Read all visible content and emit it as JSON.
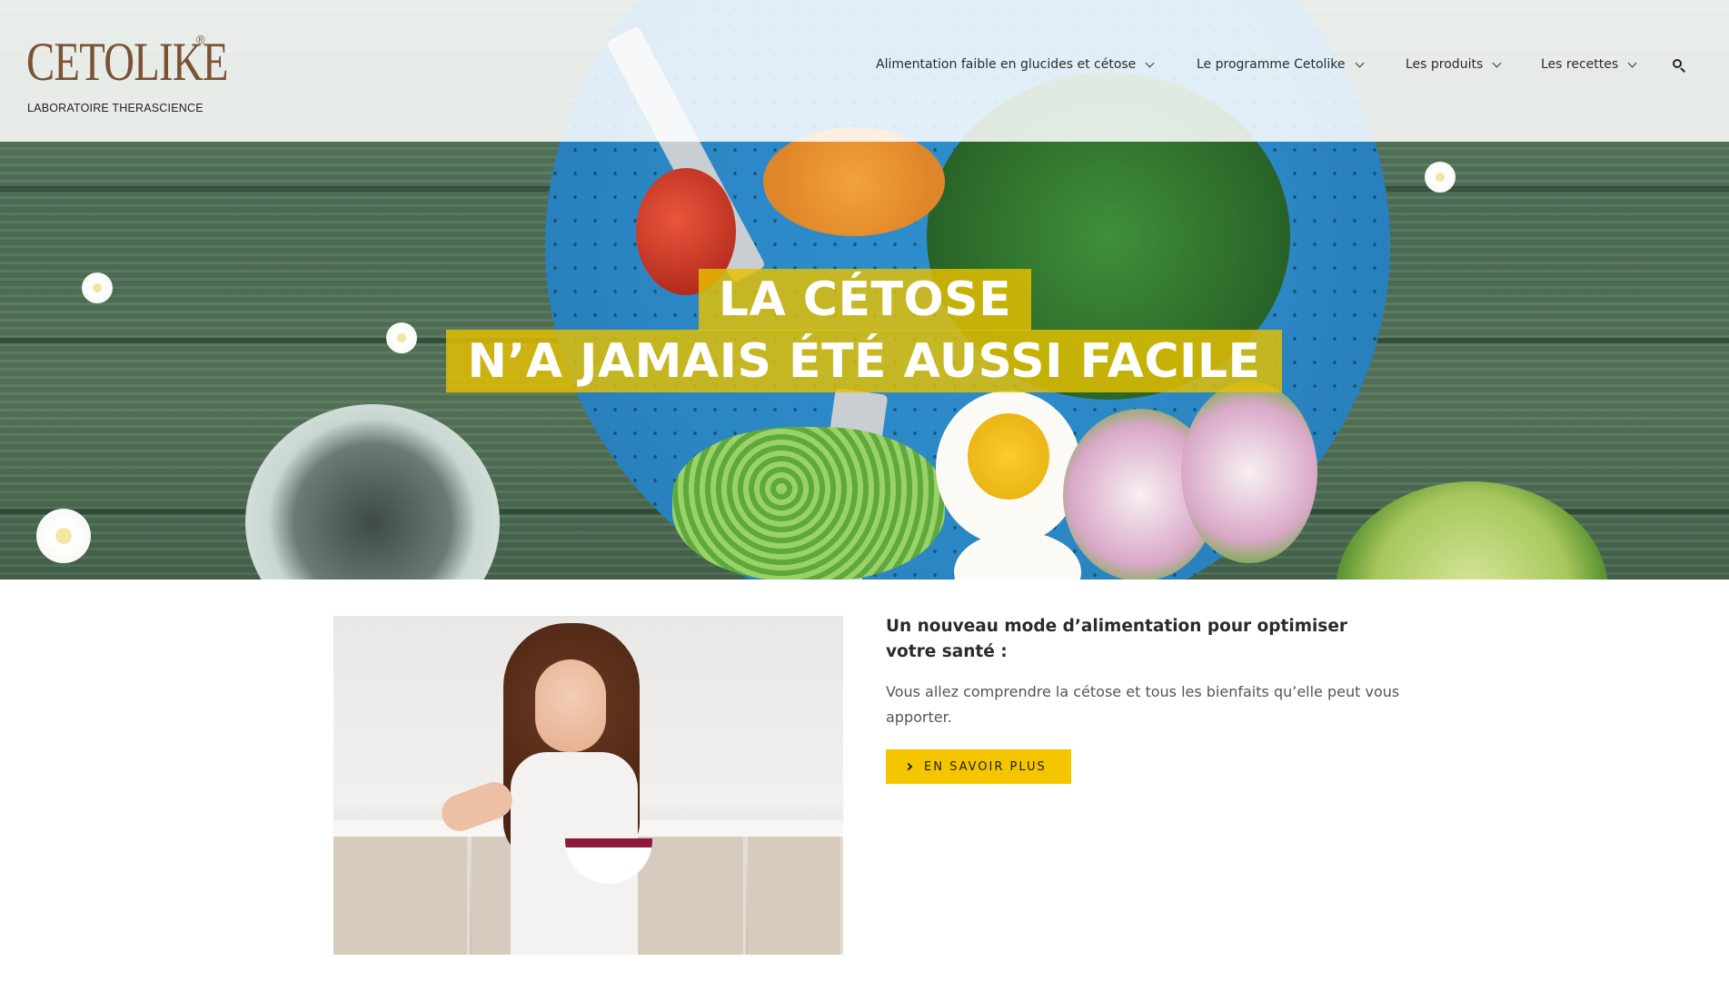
{
  "brand": {
    "logo_word": "CETOLIKE",
    "logo_registered": "®",
    "logo_subtitle": "LABORATOIRE THERASCIENCE",
    "logo_color": "#7a5234"
  },
  "nav": {
    "items": [
      {
        "label": "Alimentation faible en glucides et cétose"
      },
      {
        "label": "Le programme Cetolike"
      },
      {
        "label": "Les produits"
      },
      {
        "label": "Les recettes"
      }
    ],
    "search_icon": "search-icon"
  },
  "hero": {
    "line1": "LA CÉTOSE",
    "line2": "N’A JAMAIS ÉTÉ AUSSI FACILE",
    "highlight_color": "#e6c100"
  },
  "content": {
    "title": "Un nouveau mode d’alimentation pour optimiser votre santé :",
    "text": "Vous allez comprendre la cétose et tous les bienfaits qu’elle peut vous apporter.",
    "cta_label": "EN SAVOIR PLUS",
    "cta_color": "#f5c500"
  }
}
